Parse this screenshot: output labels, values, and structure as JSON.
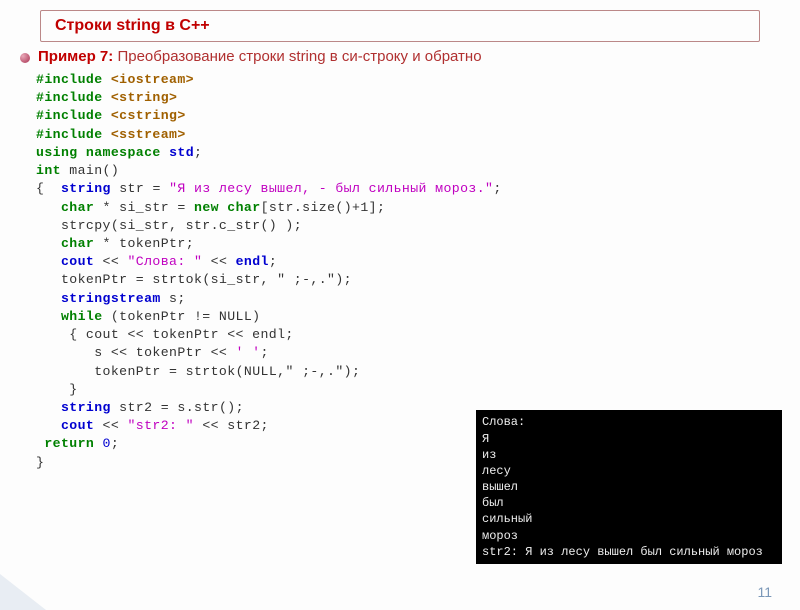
{
  "header": {
    "title": "Строки  string в C++"
  },
  "subtitle": {
    "example_label": "Пример 7:",
    "text": "Преобразование строки string в си-строку и обратно"
  },
  "code": {
    "inc1_a": "#include ",
    "inc1_b": "<iostream>",
    "inc2_a": "#include ",
    "inc2_b": "<string>",
    "inc3_a": "#include ",
    "inc3_b": "<cstring>",
    "inc4_a": "#include ",
    "inc4_b": "<sstream>",
    "using_a": "using",
    "using_b": "namespace",
    "using_c": "std",
    "semi": ";",
    "int": "int",
    "main": "main",
    "parens": "()",
    "lbrace": "{",
    "rbrace": "}",
    "string": "string",
    "str": "str",
    "eq": " = ",
    "lit_main": "\"Я из лесу вышел, - был сильный мороз.\"",
    "char": "char",
    "star": " * ",
    "si_str": "si_str",
    "new": "new",
    "charArr": "char",
    "lbrk": "[",
    "rbrk": "]",
    "strsize": "str.size()+1",
    "strcpy": "strcpy",
    "args_strcpy": "(si_str, str.c_str() )",
    "tokenPtr": "tokenPtr",
    "cout": "cout",
    "lt": " << ",
    "lit_words": "\"Слова: \"",
    "endl": "endl",
    "strtok": "strtok",
    "args_tok1": "(si_str, \" ;-,.\")",
    "stringstream": "stringstream",
    "s_var": "s",
    "while": "while",
    "cond": " (tokenPtr != NULL)",
    "inner_lbrace": "  { ",
    "inner_rbrace": "  }",
    "line_cout_tok": "cout << tokenPtr << endl;",
    "s_accum_a": "s << tokenPtr << ",
    "s_accum_lit": "' '",
    "s_accum_b": ";",
    "args_tok2": "(NULL,\" ;-,.\")",
    "str2": "str2",
    "s_str": "s.str()",
    "lit_str2": "\"str2: \"",
    "ret": "return",
    "zero": "0"
  },
  "console": "Слова:\nЯ\nиз\nлесу\nвышел\nбыл\nсильный\nмороз\nstr2: Я из лесу вышел был сильный мороз",
  "page_number": "11"
}
